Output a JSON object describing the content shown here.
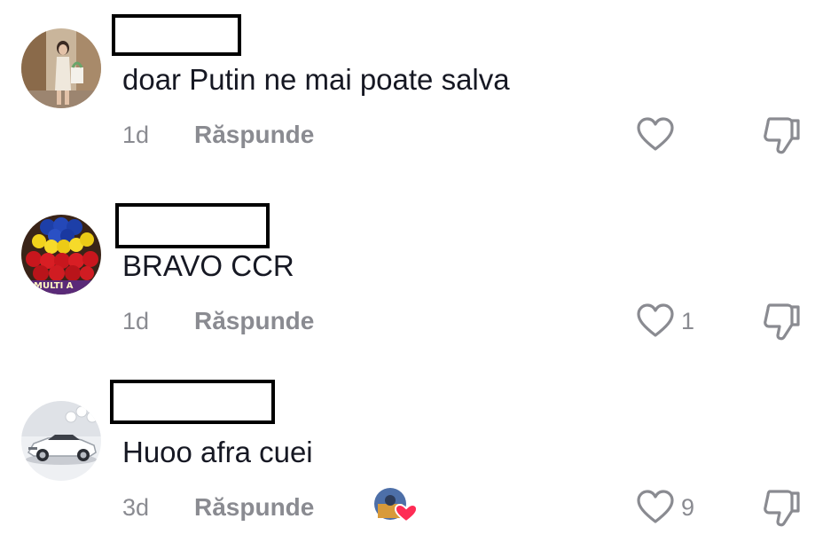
{
  "comments": [
    {
      "avatar_icon": "user-avatar-photo-woman",
      "text": "doar Putin ne mai poate salva",
      "time": "1d",
      "reply_label": "Răspunde",
      "like_count": ""
    },
    {
      "avatar_icon": "user-avatar-flag-roses",
      "avatar_caption": "MULTI A",
      "text": "BRAVO CCR",
      "time": "1d",
      "reply_label": "Răspunde",
      "like_count": "1"
    },
    {
      "avatar_icon": "user-avatar-white-car",
      "text": "Huoo afra cuei",
      "time": "3d",
      "reply_label": "Răspunde",
      "like_count": "9",
      "creator_liked_icon": "creator-liked-heart-badge"
    }
  ],
  "colors": {
    "text": "#161823",
    "muted": "#8a8b91",
    "heart_badge": "#fe2c55"
  },
  "icons": {
    "like": "heart-outline-icon",
    "dislike": "thumbs-down-outline-icon"
  }
}
